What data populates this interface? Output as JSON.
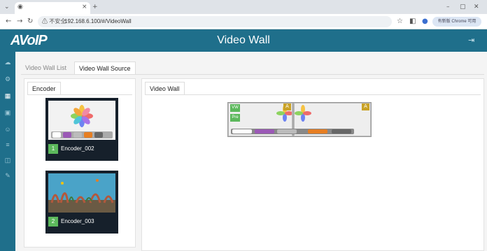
{
  "browser": {
    "address_warning": "⚠ 不安全",
    "url": "192.168.6.100/#/VideoWall",
    "profile_label": "有新版 Chrome 可用",
    "new_tab_glyph": "+",
    "close_tab_glyph": "×"
  },
  "header": {
    "logo_text": "AVoIP",
    "title": "Video Wall",
    "color": "#1f6f8b"
  },
  "tabs": [
    {
      "label": "Video Wall List",
      "active": false
    },
    {
      "label": "Video Wall Source",
      "active": true
    }
  ],
  "encoder_panel": {
    "tab_label": "Encoder",
    "encoders": [
      {
        "index": "1",
        "name": "Encoder_002",
        "preview": "photos-app-dock"
      },
      {
        "index": "2",
        "name": "Encoder_003",
        "preview": "aquarium-scene"
      }
    ]
  },
  "video_wall_panel": {
    "tab_label": "Video Wall",
    "wall": {
      "vw_label": "VW",
      "pre_label": "Pre",
      "badge_left": "A",
      "badge_right": "A",
      "badge_color": "#c9a227",
      "button_color": "#5cb85c"
    }
  },
  "sidebar": {
    "icons": [
      "cloud-icon",
      "settings-icon",
      "grid-icon",
      "display-icon",
      "user-icon",
      "list-icon",
      "wall-icon",
      "tools-icon"
    ]
  }
}
